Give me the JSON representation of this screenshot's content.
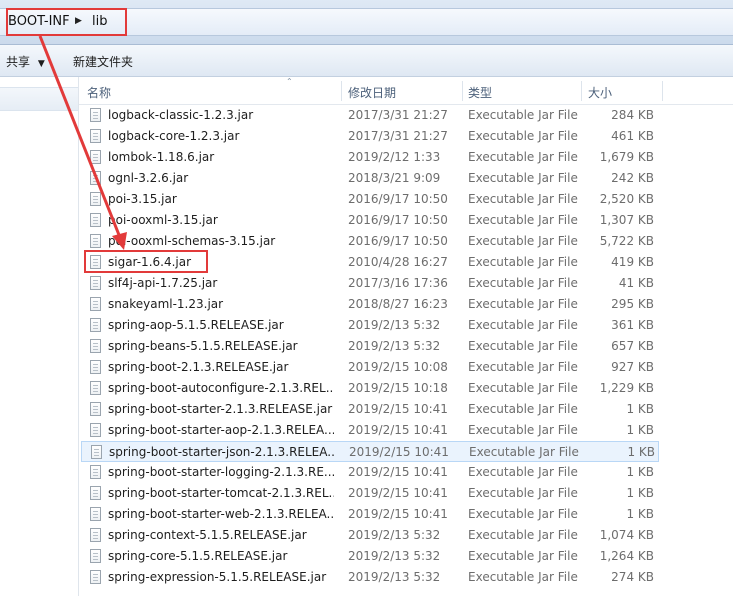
{
  "address": {
    "crumbs": [
      "BOOT-INF",
      "lib"
    ],
    "separator_icon": "triangle-right"
  },
  "toolbar": {
    "share_label": "共享",
    "share_icon": "dropdown-arrow",
    "new_folder_label": "新建文件夹"
  },
  "columns": {
    "name": "名称",
    "date": "修改日期",
    "type": "类型",
    "size": "大小"
  },
  "highlight_color": "#e23a3a",
  "selected_row_color": "#eaf3fd",
  "files": [
    {
      "name": "logback-classic-1.2.3.jar",
      "date": "2017/3/31 21:27",
      "type": "Executable Jar File",
      "size": "284 KB"
    },
    {
      "name": "logback-core-1.2.3.jar",
      "date": "2017/3/31 21:27",
      "type": "Executable Jar File",
      "size": "461 KB"
    },
    {
      "name": "lombok-1.18.6.jar",
      "date": "2019/2/12 1:33",
      "type": "Executable Jar File",
      "size": "1,679 KB"
    },
    {
      "name": "ognl-3.2.6.jar",
      "date": "2018/3/21 9:09",
      "type": "Executable Jar File",
      "size": "242 KB"
    },
    {
      "name": "poi-3.15.jar",
      "date": "2016/9/17 10:50",
      "type": "Executable Jar File",
      "size": "2,520 KB"
    },
    {
      "name": "poi-ooxml-3.15.jar",
      "date": "2016/9/17 10:50",
      "type": "Executable Jar File",
      "size": "1,307 KB"
    },
    {
      "name": "poi-ooxml-schemas-3.15.jar",
      "date": "2016/9/17 10:50",
      "type": "Executable Jar File",
      "size": "5,722 KB"
    },
    {
      "name": "sigar-1.6.4.jar",
      "date": "2010/4/28 16:27",
      "type": "Executable Jar File",
      "size": "419 KB"
    },
    {
      "name": "slf4j-api-1.7.25.jar",
      "date": "2017/3/16 17:36",
      "type": "Executable Jar File",
      "size": "41 KB"
    },
    {
      "name": "snakeyaml-1.23.jar",
      "date": "2018/8/27 16:23",
      "type": "Executable Jar File",
      "size": "295 KB"
    },
    {
      "name": "spring-aop-5.1.5.RELEASE.jar",
      "date": "2019/2/13 5:32",
      "type": "Executable Jar File",
      "size": "361 KB"
    },
    {
      "name": "spring-beans-5.1.5.RELEASE.jar",
      "date": "2019/2/13 5:32",
      "type": "Executable Jar File",
      "size": "657 KB"
    },
    {
      "name": "spring-boot-2.1.3.RELEASE.jar",
      "date": "2019/2/15 10:08",
      "type": "Executable Jar File",
      "size": "927 KB"
    },
    {
      "name": "spring-boot-autoconfigure-2.1.3.REL...",
      "date": "2019/2/15 10:18",
      "type": "Executable Jar File",
      "size": "1,229 KB"
    },
    {
      "name": "spring-boot-starter-2.1.3.RELEASE.jar",
      "date": "2019/2/15 10:41",
      "type": "Executable Jar File",
      "size": "1 KB"
    },
    {
      "name": "spring-boot-starter-aop-2.1.3.RELEA...",
      "date": "2019/2/15 10:41",
      "type": "Executable Jar File",
      "size": "1 KB"
    },
    {
      "name": "spring-boot-starter-json-2.1.3.RELEA...",
      "date": "2019/2/15 10:41",
      "type": "Executable Jar File",
      "size": "1 KB"
    },
    {
      "name": "spring-boot-starter-logging-2.1.3.RE...",
      "date": "2019/2/15 10:41",
      "type": "Executable Jar File",
      "size": "1 KB"
    },
    {
      "name": "spring-boot-starter-tomcat-2.1.3.REL...",
      "date": "2019/2/15 10:41",
      "type": "Executable Jar File",
      "size": "1 KB"
    },
    {
      "name": "spring-boot-starter-web-2.1.3.RELEA...",
      "date": "2019/2/15 10:41",
      "type": "Executable Jar File",
      "size": "1 KB"
    },
    {
      "name": "spring-context-5.1.5.RELEASE.jar",
      "date": "2019/2/13 5:32",
      "type": "Executable Jar File",
      "size": "1,074 KB"
    },
    {
      "name": "spring-core-5.1.5.RELEASE.jar",
      "date": "2019/2/13 5:32",
      "type": "Executable Jar File",
      "size": "1,264 KB"
    },
    {
      "name": "spring-expression-5.1.5.RELEASE.jar",
      "date": "2019/2/13 5:32",
      "type": "Executable Jar File",
      "size": "274 KB"
    }
  ]
}
